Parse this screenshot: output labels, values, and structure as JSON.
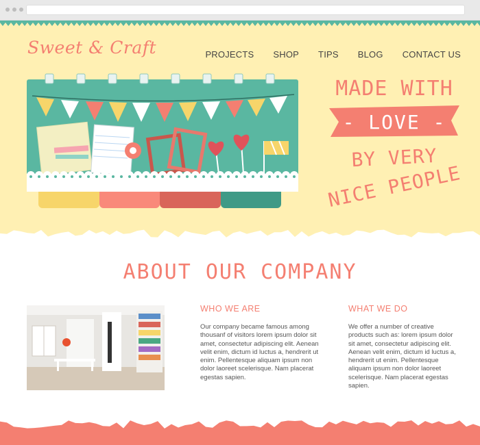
{
  "site": {
    "logo": "Sweet & Craft",
    "nav": [
      "PROJECTS",
      "SHOP",
      "TIPS",
      "BLOG",
      "CONTACT US"
    ]
  },
  "hero": {
    "line1": "MADE WITH",
    "ribbon": "- LOVE -",
    "line3": "BY VERY",
    "line4": "NICE PEOPLE"
  },
  "about": {
    "title": "ABOUT OUR COMPANY",
    "col1": {
      "heading": "WHO WE ARE",
      "text": "Our company became famous among thousanf of visitors lorem ipsum dolor sit amet, consectetur adipiscing elit. Aenean velit enim, dictum id luctus a, hendrerit ut enim. Pellentesque aliquam ipsum non dolor laoreet scelerisque. Nam placerat egestas sapien."
    },
    "col2": {
      "heading": "WHAT WE DO",
      "text": "We offer a number of creative products such as: lorem ipsum dolor sit amet, consectetur adipiscing elit. Aenean velit enim, dictum id luctus a, hendrerit ut enim. Pellentesque aliquam ipsum non dolor laoreet scelerisque. Nam placerat egestas sapien."
    }
  },
  "colors": {
    "accent": "#f47f71",
    "hero_bg": "#fff0b3",
    "teal": "#5ab7a1",
    "yellow": "#f7d56a",
    "tab_coral": "#f9897a",
    "tab_red": "#d9655a",
    "tab_teal": "#3f9a86"
  }
}
